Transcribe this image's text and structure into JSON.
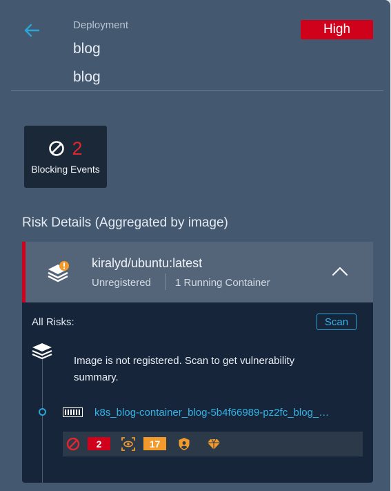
{
  "header": {
    "resource_kind": "Deployment",
    "resource_name": "blog",
    "namespace": "blog",
    "severity": "High",
    "severity_color": "#d0021b"
  },
  "blocking_events": {
    "count": "2",
    "label": "Blocking Events",
    "icon": "blocked-icon"
  },
  "risk_details": {
    "title": "Risk Details (Aggregated by image)",
    "image": {
      "name": "kiralyd/ubuntu:latest",
      "registration": "Unregistered",
      "running": "1 Running Container",
      "icon": "image-layers-warning-icon"
    },
    "all_risks_label": "All Risks:",
    "scan_label": "Scan",
    "unregistered_message": "Image is not registered. Scan to get vulnerability summary.",
    "container": {
      "name": "k8s_blog-container_blog-5b4f66989-pz2fc_blog_…",
      "stats": {
        "blocking_count": "2",
        "audit_count": "17"
      }
    }
  },
  "colors": {
    "panel_bg": "#445870",
    "accent_blue": "#33b3e6",
    "danger_red": "#d0021b",
    "warning_orange": "#f39a2d"
  }
}
